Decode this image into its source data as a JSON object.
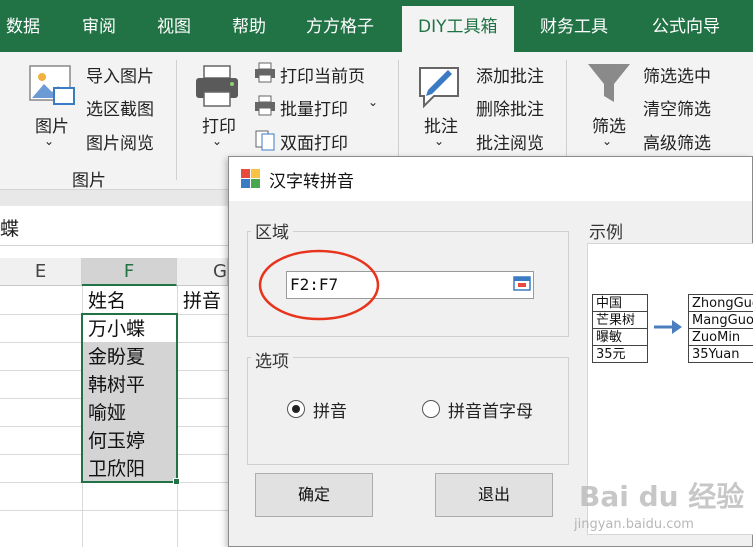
{
  "tabs": [
    {
      "label": "数据"
    },
    {
      "label": "审阅"
    },
    {
      "label": "视图"
    },
    {
      "label": "帮助"
    },
    {
      "label": "方方格子"
    },
    {
      "label": "DIY工具箱",
      "active": true
    },
    {
      "label": "财务工具"
    },
    {
      "label": "公式向导"
    }
  ],
  "ribbon": {
    "picture_group": {
      "big_button": "图片",
      "items": [
        "导入图片",
        "选区截图",
        "图片阅览"
      ],
      "group_label": "图片"
    },
    "print_group": {
      "big_button": "打印",
      "items": [
        "打印当前页",
        "批量打印",
        "双面打印"
      ]
    },
    "comment_group": {
      "big_button": "批注",
      "items": [
        "添加批注",
        "删除批注",
        "批注阅览"
      ]
    },
    "filter_group": {
      "big_button": "筛选",
      "items": [
        "筛选选中",
        "清空筛选",
        "高级筛选"
      ]
    }
  },
  "formula_bar": {
    "value_fragment": "蝶"
  },
  "sheet": {
    "columns": [
      "E",
      "F",
      "G"
    ],
    "header_row": {
      "F": "姓名",
      "G": "拼音"
    },
    "names": [
      "万小蝶",
      "金盼夏",
      "韩树平",
      "喻娅",
      "何玉婷",
      "卫欣阳"
    ]
  },
  "dialog": {
    "title": "汉字转拼音",
    "region_label": "区域",
    "range_value": "F2:F7",
    "options_label": "选项",
    "option_pinyin": "拼音",
    "option_initials": "拼音首字母",
    "selected_option": "拼音",
    "ok_label": "确定",
    "exit_label": "退出",
    "example_label": "示例",
    "example": {
      "left": [
        "中国",
        "芒果树",
        "曝敏",
        "35元"
      ],
      "right": [
        "ZhongGuo",
        "MangGuoShu",
        "ZuoMin",
        "35Yuan"
      ]
    }
  },
  "watermark": {
    "text": "Bai du 经验",
    "sub": "jingyan.baidu.com"
  },
  "colors": {
    "tab_bar": "#217346",
    "selection_border": "#217346",
    "annotation_circle": "#e8341c",
    "arrow": "#4a7ebf"
  }
}
